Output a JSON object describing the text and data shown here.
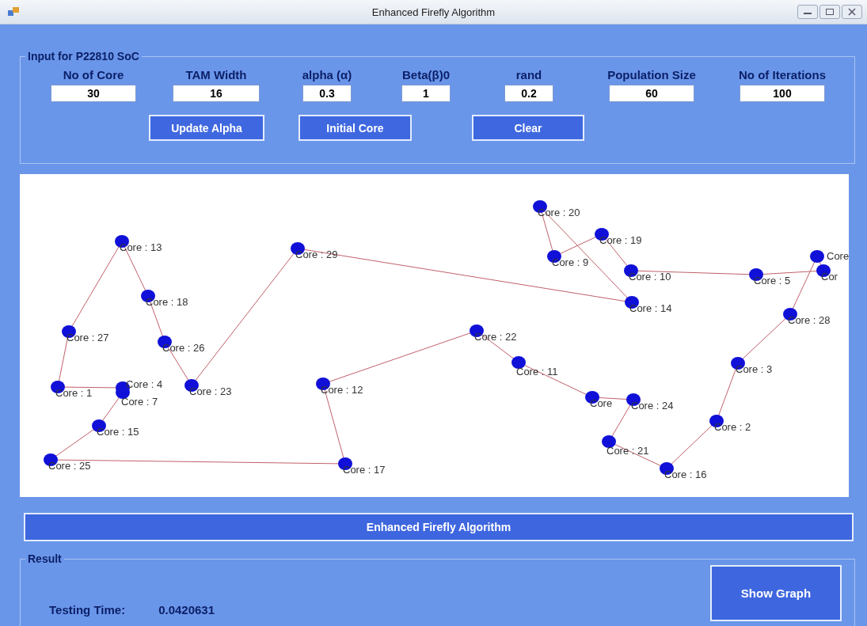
{
  "window": {
    "title": "Enhanced Firefly Algorithm"
  },
  "input_group": {
    "title": "Input for P22810 SoC",
    "fields": [
      {
        "label": "No of Core",
        "value": "30"
      },
      {
        "label": "TAM Width",
        "value": "16"
      },
      {
        "label": "alpha (α)",
        "value": "0.3"
      },
      {
        "label": "Beta(β)0",
        "value": "1"
      },
      {
        "label": "rand",
        "value": "0.2"
      },
      {
        "label": "Population Size",
        "value": "60"
      },
      {
        "label": "No of Iterations",
        "value": "100"
      }
    ],
    "buttons": [
      "Update Alpha",
      "Initial Core",
      "Clear"
    ]
  },
  "graph": {
    "nodes": [
      {
        "label": "Core : 20"
      },
      {
        "label": "Core : 19"
      },
      {
        "label": "Core : 13"
      },
      {
        "label": "Core : 29"
      },
      {
        "label": "Core : 9"
      },
      {
        "label": "Core"
      },
      {
        "label": "Core : 10"
      },
      {
        "label": "Cor"
      },
      {
        "label": "Core : 5"
      },
      {
        "label": "Core : 18"
      },
      {
        "label": "Core : 14"
      },
      {
        "label": "Core : 28"
      },
      {
        "label": "Core : 22"
      },
      {
        "label": "Core : 27"
      },
      {
        "label": "Core : 26"
      },
      {
        "label": "Core : 11"
      },
      {
        "label": "Core : 3"
      },
      {
        "label": "Core : 1"
      },
      {
        "label": "Core : 4"
      },
      {
        "label": "Core : 7"
      },
      {
        "label": "Core : 23"
      },
      {
        "label": "Core : 12"
      },
      {
        "label": "Core"
      },
      {
        "label": "Core : 24"
      },
      {
        "label": "Core : 2"
      },
      {
        "label": "Core : 15"
      },
      {
        "label": "Core : 21"
      },
      {
        "label": "Core : 25"
      },
      {
        "label": "Core : 17"
      },
      {
        "label": "Core : 16"
      }
    ]
  },
  "banner": "Enhanced Firefly Algorithm",
  "result_group": {
    "title": "Result",
    "label": "Testing Time:",
    "value": "0.0420631",
    "button": "Show Graph"
  }
}
